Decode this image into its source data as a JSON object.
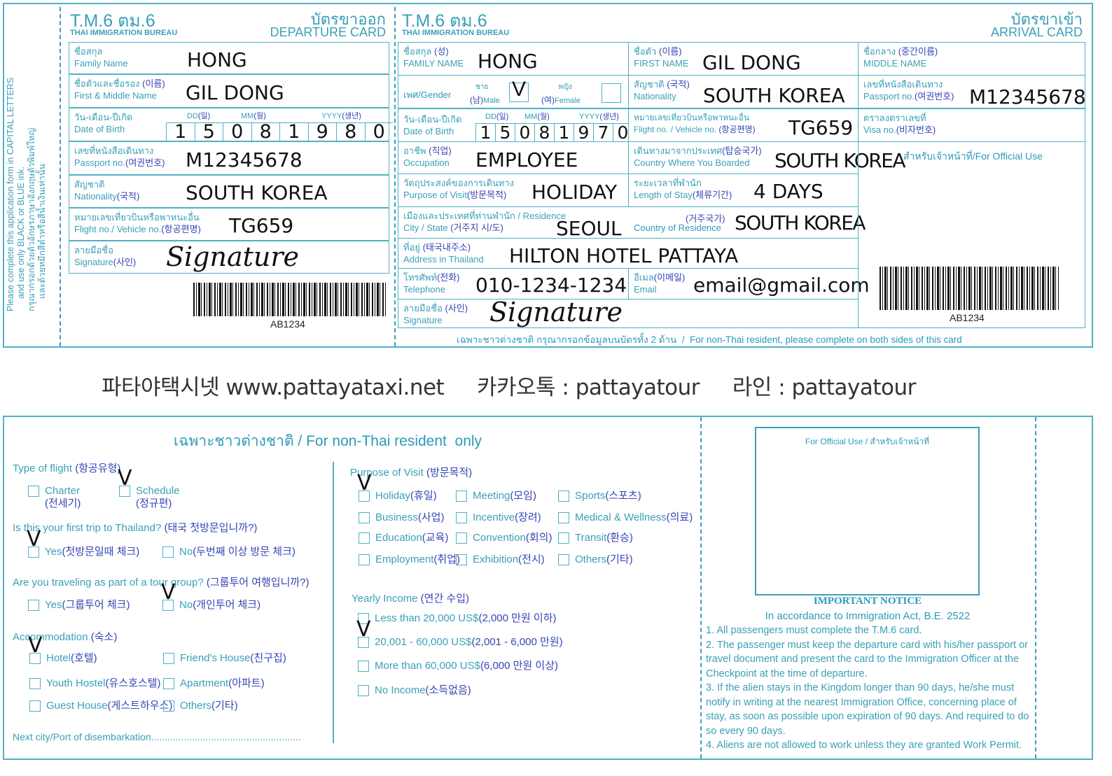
{
  "colors": {
    "border": "#4fb0c6",
    "label": "#3a9fb8",
    "korean": "#3545b5",
    "value": "#111111"
  },
  "side_note": {
    "en1": "Please complete this application form in CAPITAL LETTERS",
    "en2": "and use only BLACK or BLUE ink.",
    "th1": "กรุณากรอกด้วยตัวอักษรภาษาอังกฤษตัวพิมพ์ใหญ่",
    "th2": "และด้วยหมึกสีดำหรือสีน้ำเงินเท่านั้น"
  },
  "departure": {
    "code": "T.M.6 ตม.6",
    "bureau": "THAI IMMIGRATION BUREAU",
    "title_th": "บัตรขาออก",
    "title_en": "DEPARTURE CARD",
    "family": {
      "th": "ชื่อสกุล",
      "ko": "(성)",
      "en": "Family Name",
      "value": "HONG"
    },
    "first": {
      "th": "ชื่อตัวและชื่อรอง",
      "ko": "(이름)",
      "en": "First & Middle Name",
      "value": "GIL DONG"
    },
    "dob": {
      "th": "วัน-เดือน-ปีเกิด",
      "en": "Date of Birth",
      "dd": "DD",
      "dd_ko": "(일)",
      "mm": "MM",
      "mm_ko": "(월)",
      "yyyy": "YYYY",
      "yyyy_ko": "(생년)",
      "digits": [
        "1",
        "5",
        "0",
        "8",
        "1",
        "9",
        "8",
        "0"
      ]
    },
    "passport": {
      "th": "เลขที่หนังสือเดินทาง",
      "en": "Passport no.",
      "ko": "(여권번호)",
      "value": "M12345678"
    },
    "nationality": {
      "th": "สัญชาติ",
      "en": "Nationality",
      "ko": "(국적)",
      "value": "SOUTH KOREA"
    },
    "flight": {
      "th": "หมายเลขเที่ยวบินหรือพาหนะอื่น",
      "en": "Flight no./ Vehicle no.",
      "ko": "(항공편명)",
      "value": "TG659"
    },
    "signature": {
      "th": "ลายมือชื่อ",
      "en": "Signature",
      "ko": "(사인)",
      "value": "Signature"
    },
    "barcode": "AB1234"
  },
  "arrival": {
    "code": "T.M.6 ตม.6",
    "bureau": "THAI IMMIGRATION BUREAU",
    "title_th": "บัตรขาเข้า",
    "title_en": "ARRIVAL CARD",
    "family": {
      "th": "ชื่อสกุล",
      "ko": "(성)",
      "en": "FAMILY NAME",
      "value": "HONG"
    },
    "first": {
      "th": "ชื่อตัว",
      "ko": "(이름)",
      "en": "FIRST NAME",
      "value": "GIL DONG"
    },
    "middle": {
      "th": "ชื่อกลาง",
      "ko": "(중간이름)",
      "en": "MIDDLE NAME",
      "value": ""
    },
    "gender": {
      "label": "เพศ/Gender",
      "male_th": "ชาย",
      "male_ko": "(남)",
      "male": "Male",
      "male_mark": "V",
      "female_th": "หญิง",
      "female_ko": "(여)",
      "female": "Female"
    },
    "nationality": {
      "th": "สัญชาติ",
      "ko": "(국적)",
      "en": "Nationality",
      "value": "SOUTH KOREA"
    },
    "passport": {
      "th": "เลขที่หนังสือเดินทาง",
      "en": "Passport no.",
      "ko": "(여권번호)",
      "value": "M12345678"
    },
    "dob": {
      "th": "วัน-เดือน-ปีเกิด",
      "en": "Date of Birth",
      "dd": "DD",
      "dd_ko": "(일)",
      "mm": "MM",
      "mm_ko": "(월)",
      "yyyy": "YYYY",
      "yyyy_ko": "(생년)",
      "digits": [
        "1",
        "5",
        "0",
        "8",
        "1",
        "9",
        "7",
        "0"
      ]
    },
    "flight": {
      "th": "หมายเลขเที่ยวบินหรือพาหนะอื่น",
      "en": "Flight no. / Vehicle no.",
      "ko": "(항공편명)",
      "value": "TG659"
    },
    "visa": {
      "th": "ตราลงตราเลขที่",
      "en": "Visa no.",
      "ko": "(비자번호)",
      "value": ""
    },
    "occupation": {
      "th": "อาชีพ",
      "ko": "(직업)",
      "en": "Occupation",
      "value": "EMPLOYEE"
    },
    "boarded": {
      "th": "เดินทางมาจากประเทศ",
      "ko": "(탑승국가)",
      "en": "Country Where You Boarded",
      "value": "SOUTH KOREA"
    },
    "official": "สำหรับเจ้าหน้าที่/For Official Use",
    "purpose": {
      "th": "วัตถุประสงค์ของการเดินทาง",
      "en": "Purpose of Visit",
      "ko": "(방문목적)",
      "value": "HOLIDAY"
    },
    "stay": {
      "th": "ระยะเวลาที่พำนัก",
      "en": "Length of Stay",
      "ko": "(체류기간)",
      "value": "4 DAYS"
    },
    "residence": {
      "th": "เมืองและประเทศที่ท่านพำนัก / Residence",
      "en": "City / State",
      "ko": "(거주지 시/도)",
      "value": "SEOUL",
      "country_ko": "(거주국가)",
      "country_en": "Country of Residence",
      "country_value": "SOUTH KOREA"
    },
    "address": {
      "th": "ที่อยู่",
      "ko": "(태국내주소)",
      "en": "Address in Thailand",
      "value": "HILTON HOTEL PATTAYA"
    },
    "telephone": {
      "th": "โทรศัพท์",
      "ko": "(전화)",
      "en": "Telephone",
      "value": "010-1234-1234"
    },
    "email": {
      "th": "อีเมล",
      "ko": "(이메일)",
      "en": "Email",
      "value": "email@gmail.com"
    },
    "signature": {
      "th": "ลายมือชื่อ",
      "ko": "(사인)",
      "en": "Signature",
      "value": "Signature"
    },
    "barcode": "AB1234",
    "footer": "เฉพาะชาวต่างชาติ กรุณากรอกข้อมูลบนบัตรทั้ง 2 ด้าน  /  For non-Thai resident, please complete on both sides of this card"
  },
  "promo": "파타야택시넷 www.pattayataxi.net     카카오톡 : pattayatour     라인 : pattayatour",
  "back": {
    "heading": "เฉพาะชาวต่างชาติ / For non-Thai resident  only",
    "flight_type": {
      "q": "Type of flight",
      "ko": "(항공유형)",
      "options": [
        {
          "label": "Charter",
          "ko": "(전세기)",
          "checked": false
        },
        {
          "label": "Schedule",
          "ko": "(정규편)",
          "checked": true
        }
      ]
    },
    "first_trip": {
      "q": "Is this your first trip to Thailand?",
      "ko": "(태국 첫방문입니까?)",
      "options": [
        {
          "label": "Yes",
          "ko": "(첫방문일때 체크)",
          "checked": true
        },
        {
          "label": "No",
          "ko": "(두번째 이상 방문 체크)",
          "checked": false
        }
      ]
    },
    "tour_group": {
      "q": "Are you traveling as part of a tour group?",
      "ko": "(그룹투어 여행입니까?)",
      "options": [
        {
          "label": "Yes",
          "ko": "(그룹투어 체크)",
          "checked": false
        },
        {
          "label": "No",
          "ko": "(개인투어 체크)",
          "checked": true
        }
      ]
    },
    "accommodation": {
      "q": "Accommodation",
      "ko": "(숙소)",
      "options": [
        {
          "label": "Hotel",
          "ko": "(호텔)",
          "checked": true
        },
        {
          "label": "Friend's House",
          "ko": "(친구집)",
          "checked": false
        },
        {
          "label": "Youth Hostel",
          "ko": "(유스호스텔)",
          "checked": false
        },
        {
          "label": "Apartment",
          "ko": "(아파트)",
          "checked": false
        },
        {
          "label": "Guest House",
          "ko": "(게스트하우스)",
          "checked": false
        },
        {
          "label": "Others",
          "ko": "(기타)",
          "checked": false
        }
      ]
    },
    "next_city": "Next city/Port of disembarkation.......................................................",
    "purpose": {
      "q": "Purpose of Visit",
      "ko": "(방문목적)",
      "options": [
        {
          "label": "Holiday",
          "ko": "(휴일)",
          "checked": true
        },
        {
          "label": "Meeting",
          "ko": "(모임)",
          "checked": false
        },
        {
          "label": "Sports",
          "ko": "(스포츠)",
          "checked": false
        },
        {
          "label": "Business",
          "ko": "(사업)",
          "checked": false
        },
        {
          "label": "Incentive",
          "ko": "(장려)",
          "checked": false
        },
        {
          "label": "Medical & Wellness",
          "ko": "(의료)",
          "checked": false
        },
        {
          "label": "Education",
          "ko": "(교육)",
          "checked": false
        },
        {
          "label": "Convention",
          "ko": "(회의)",
          "checked": false
        },
        {
          "label": "Transit",
          "ko": "(환승)",
          "checked": false
        },
        {
          "label": "Employment",
          "ko": "(취업)",
          "checked": false
        },
        {
          "label": "Exhibition",
          "ko": "(전시)",
          "checked": false
        },
        {
          "label": "Others",
          "ko": "(기타)",
          "checked": false
        }
      ]
    },
    "income": {
      "q": "Yearly Income",
      "ko": "(연간 수입)",
      "options": [
        {
          "label": "Less than 20,000 US$",
          "ko": "(2,000 만원 이하)",
          "checked": false
        },
        {
          "label": "20,001 - 60,000 US$",
          "ko": "(2,001 - 6,000 만원)",
          "checked": true
        },
        {
          "label": "More than 60,000 US$",
          "ko": "(6,000 만원 이상)",
          "checked": false
        },
        {
          "label": "No Income",
          "ko": "(소득없음)",
          "checked": false
        }
      ]
    },
    "official": "For Official Use / สำหรับเจ้าหน้าที่",
    "notice_title": "IMPORTANT NOTICE",
    "notice_sub": "In accordance to Immigration Act, B.E. 2522",
    "notice_items": [
      "1. All passengers must complete the T.M.6 card.",
      "2. The passenger must keep the departure card with his/her passport or travel document and present the card to the Immigration Officer at the Checkpoint at the time of departure.",
      "3. If the alien stays in the Kingdom longer than 90 days, he/she must notify in writing at the nearest Immigration Office, concerning place of stay, as soon as possible upon expiration of 90 days. And required to do so every 90 days.",
      "4. Aliens are not allowed to work unless they are granted Work Permit."
    ]
  }
}
